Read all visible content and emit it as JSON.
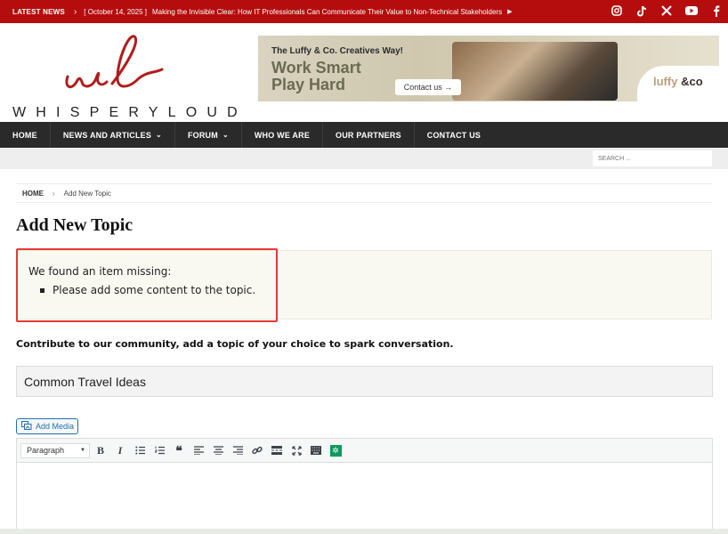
{
  "newsbar": {
    "label": "LATEST NEWS",
    "date": "[ October 14, 2025 ]",
    "headline": "Making the Invisible Clear: How IT Professionals Can Communicate Their Value to Non-Technical Stakeholders",
    "social": [
      "instagram-icon",
      "tiktok-icon",
      "x-icon",
      "youtube-icon",
      "facebook-icon"
    ]
  },
  "logo": {
    "wordmark": "WHISPERYLOUD"
  },
  "ad": {
    "tagline": "The Luffy & Co. Creatives Way!",
    "line1": "Work Smart",
    "line2": "Play Hard",
    "cta": "Contact us →",
    "brand_a": "luffy",
    "brand_b": "&co"
  },
  "nav": {
    "items": [
      {
        "label": "HOME",
        "caret": false
      },
      {
        "label": "NEWS AND ARTICLES",
        "caret": true
      },
      {
        "label": "FORUM",
        "caret": true
      },
      {
        "label": "WHO WE ARE",
        "caret": false
      },
      {
        "label": "OUR PARTNERS",
        "caret": false
      },
      {
        "label": "CONTACT US",
        "caret": false
      }
    ]
  },
  "search": {
    "placeholder": "SEARCH ..."
  },
  "breadcrumb": {
    "home": "HOME",
    "current": "Add New Topic"
  },
  "page": {
    "title": "Add New Topic",
    "notice_heading": "We found an item missing:",
    "notice_items": [
      "Please add some content to the topic."
    ],
    "intro": "Contribute to our community, add a topic of your choice to spark conversation.",
    "topic_title_value": "Common Travel Ideas"
  },
  "editor": {
    "add_media": "Add Media",
    "format_selected": "Paragraph"
  },
  "colors": {
    "newsbar": "#b50d0d",
    "nav": "#2a2a2a",
    "logo_red": "#b01c1c",
    "highlight": "#e53935"
  }
}
